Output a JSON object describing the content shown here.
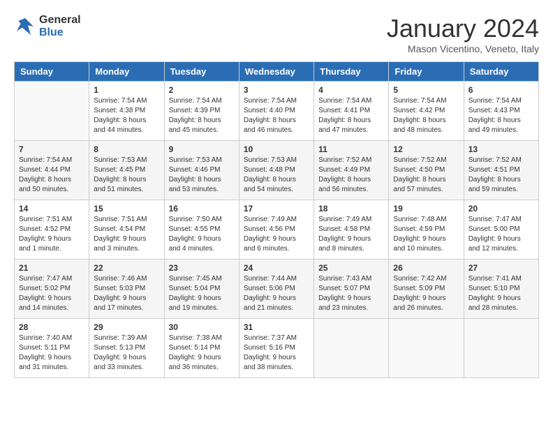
{
  "header": {
    "logo_line1": "General",
    "logo_line2": "Blue",
    "title": "January 2024",
    "subtitle": "Mason Vicentino, Veneto, Italy"
  },
  "weekdays": [
    "Sunday",
    "Monday",
    "Tuesday",
    "Wednesday",
    "Thursday",
    "Friday",
    "Saturday"
  ],
  "weeks": [
    [
      {
        "day": "",
        "sunrise": "",
        "sunset": "",
        "daylight": ""
      },
      {
        "day": "1",
        "sunrise": "Sunrise: 7:54 AM",
        "sunset": "Sunset: 4:38 PM",
        "daylight": "Daylight: 8 hours and 44 minutes."
      },
      {
        "day": "2",
        "sunrise": "Sunrise: 7:54 AM",
        "sunset": "Sunset: 4:39 PM",
        "daylight": "Daylight: 8 hours and 45 minutes."
      },
      {
        "day": "3",
        "sunrise": "Sunrise: 7:54 AM",
        "sunset": "Sunset: 4:40 PM",
        "daylight": "Daylight: 8 hours and 46 minutes."
      },
      {
        "day": "4",
        "sunrise": "Sunrise: 7:54 AM",
        "sunset": "Sunset: 4:41 PM",
        "daylight": "Daylight: 8 hours and 47 minutes."
      },
      {
        "day": "5",
        "sunrise": "Sunrise: 7:54 AM",
        "sunset": "Sunset: 4:42 PM",
        "daylight": "Daylight: 8 hours and 48 minutes."
      },
      {
        "day": "6",
        "sunrise": "Sunrise: 7:54 AM",
        "sunset": "Sunset: 4:43 PM",
        "daylight": "Daylight: 8 hours and 49 minutes."
      }
    ],
    [
      {
        "day": "7",
        "sunrise": "Sunrise: 7:54 AM",
        "sunset": "Sunset: 4:44 PM",
        "daylight": "Daylight: 8 hours and 50 minutes."
      },
      {
        "day": "8",
        "sunrise": "Sunrise: 7:53 AM",
        "sunset": "Sunset: 4:45 PM",
        "daylight": "Daylight: 8 hours and 51 minutes."
      },
      {
        "day": "9",
        "sunrise": "Sunrise: 7:53 AM",
        "sunset": "Sunset: 4:46 PM",
        "daylight": "Daylight: 8 hours and 53 minutes."
      },
      {
        "day": "10",
        "sunrise": "Sunrise: 7:53 AM",
        "sunset": "Sunset: 4:48 PM",
        "daylight": "Daylight: 8 hours and 54 minutes."
      },
      {
        "day": "11",
        "sunrise": "Sunrise: 7:52 AM",
        "sunset": "Sunset: 4:49 PM",
        "daylight": "Daylight: 8 hours and 56 minutes."
      },
      {
        "day": "12",
        "sunrise": "Sunrise: 7:52 AM",
        "sunset": "Sunset: 4:50 PM",
        "daylight": "Daylight: 8 hours and 57 minutes."
      },
      {
        "day": "13",
        "sunrise": "Sunrise: 7:52 AM",
        "sunset": "Sunset: 4:51 PM",
        "daylight": "Daylight: 8 hours and 59 minutes."
      }
    ],
    [
      {
        "day": "14",
        "sunrise": "Sunrise: 7:51 AM",
        "sunset": "Sunset: 4:52 PM",
        "daylight": "Daylight: 9 hours and 1 minute."
      },
      {
        "day": "15",
        "sunrise": "Sunrise: 7:51 AM",
        "sunset": "Sunset: 4:54 PM",
        "daylight": "Daylight: 9 hours and 3 minutes."
      },
      {
        "day": "16",
        "sunrise": "Sunrise: 7:50 AM",
        "sunset": "Sunset: 4:55 PM",
        "daylight": "Daylight: 9 hours and 4 minutes."
      },
      {
        "day": "17",
        "sunrise": "Sunrise: 7:49 AM",
        "sunset": "Sunset: 4:56 PM",
        "daylight": "Daylight: 9 hours and 6 minutes."
      },
      {
        "day": "18",
        "sunrise": "Sunrise: 7:49 AM",
        "sunset": "Sunset: 4:58 PM",
        "daylight": "Daylight: 9 hours and 8 minutes."
      },
      {
        "day": "19",
        "sunrise": "Sunrise: 7:48 AM",
        "sunset": "Sunset: 4:59 PM",
        "daylight": "Daylight: 9 hours and 10 minutes."
      },
      {
        "day": "20",
        "sunrise": "Sunrise: 7:47 AM",
        "sunset": "Sunset: 5:00 PM",
        "daylight": "Daylight: 9 hours and 12 minutes."
      }
    ],
    [
      {
        "day": "21",
        "sunrise": "Sunrise: 7:47 AM",
        "sunset": "Sunset: 5:02 PM",
        "daylight": "Daylight: 9 hours and 14 minutes."
      },
      {
        "day": "22",
        "sunrise": "Sunrise: 7:46 AM",
        "sunset": "Sunset: 5:03 PM",
        "daylight": "Daylight: 9 hours and 17 minutes."
      },
      {
        "day": "23",
        "sunrise": "Sunrise: 7:45 AM",
        "sunset": "Sunset: 5:04 PM",
        "daylight": "Daylight: 9 hours and 19 minutes."
      },
      {
        "day": "24",
        "sunrise": "Sunrise: 7:44 AM",
        "sunset": "Sunset: 5:06 PM",
        "daylight": "Daylight: 9 hours and 21 minutes."
      },
      {
        "day": "25",
        "sunrise": "Sunrise: 7:43 AM",
        "sunset": "Sunset: 5:07 PM",
        "daylight": "Daylight: 9 hours and 23 minutes."
      },
      {
        "day": "26",
        "sunrise": "Sunrise: 7:42 AM",
        "sunset": "Sunset: 5:09 PM",
        "daylight": "Daylight: 9 hours and 26 minutes."
      },
      {
        "day": "27",
        "sunrise": "Sunrise: 7:41 AM",
        "sunset": "Sunset: 5:10 PM",
        "daylight": "Daylight: 9 hours and 28 minutes."
      }
    ],
    [
      {
        "day": "28",
        "sunrise": "Sunrise: 7:40 AM",
        "sunset": "Sunset: 5:11 PM",
        "daylight": "Daylight: 9 hours and 31 minutes."
      },
      {
        "day": "29",
        "sunrise": "Sunrise: 7:39 AM",
        "sunset": "Sunset: 5:13 PM",
        "daylight": "Daylight: 9 hours and 33 minutes."
      },
      {
        "day": "30",
        "sunrise": "Sunrise: 7:38 AM",
        "sunset": "Sunset: 5:14 PM",
        "daylight": "Daylight: 9 hours and 36 minutes."
      },
      {
        "day": "31",
        "sunrise": "Sunrise: 7:37 AM",
        "sunset": "Sunset: 5:16 PM",
        "daylight": "Daylight: 9 hours and 38 minutes."
      },
      {
        "day": "",
        "sunrise": "",
        "sunset": "",
        "daylight": ""
      },
      {
        "day": "",
        "sunrise": "",
        "sunset": "",
        "daylight": ""
      },
      {
        "day": "",
        "sunrise": "",
        "sunset": "",
        "daylight": ""
      }
    ]
  ]
}
